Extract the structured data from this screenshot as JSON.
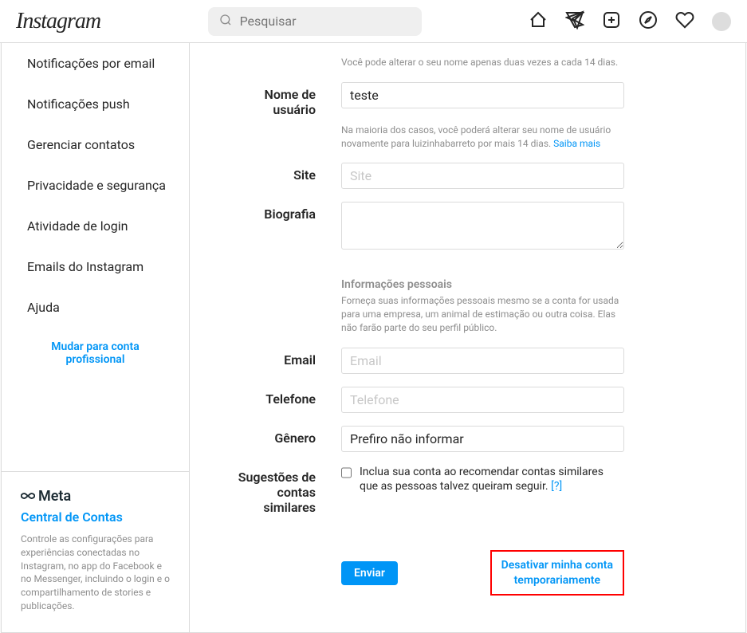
{
  "nav": {
    "logo": "Instagram",
    "search_placeholder": "Pesquisar"
  },
  "sidebar": {
    "items": [
      "Notificações por email",
      "Notificações push",
      "Gerenciar contatos",
      "Privacidade e segurança",
      "Atividade de login",
      "Emails do Instagram",
      "Ajuda"
    ],
    "switch_link_line1": "Mudar para conta",
    "switch_link_line2": "profissional"
  },
  "meta": {
    "brand": "Meta",
    "title": "Central de Contas",
    "desc": "Controle as configurações para experiências conectadas no Instagram, no app do Facebook e no Messenger, incluindo o login e o compartilhamento de stories e publicações."
  },
  "form": {
    "name_help": "Você pode alterar o seu nome apenas duas vezes a cada 14 dias.",
    "username_label": "Nome de usuário",
    "username_value": "teste",
    "username_help_text": "Na maioria dos casos, você poderá alterar seu nome de usuário novamente para luizinhabarreto por mais 14 dias. ",
    "username_help_link": "Saiba mais",
    "site_label": "Site",
    "site_placeholder": "Site",
    "bio_label": "Biografia",
    "personal_section_title": "Informações pessoais",
    "personal_section_desc": "Forneça suas informações pessoais mesmo se a conta for usada para uma empresa, um animal de estimação ou outra coisa. Elas não farão parte do seu perfil público.",
    "email_label": "Email",
    "email_placeholder": "Email",
    "phone_label": "Telefone",
    "phone_placeholder": "Telefone",
    "gender_label": "Gênero",
    "gender_value": "Prefiro não informar",
    "suggest_label_line1": "Sugestões de",
    "suggest_label_line2": "contas similares",
    "suggest_checkbox_text": "Inclua sua conta ao recomendar contas similares que as pessoas talvez queiram seguir.",
    "suggest_checkbox_q": "[?]",
    "submit": "Enviar",
    "deactivate_line1": "Desativar minha conta",
    "deactivate_line2": "temporariamente"
  }
}
